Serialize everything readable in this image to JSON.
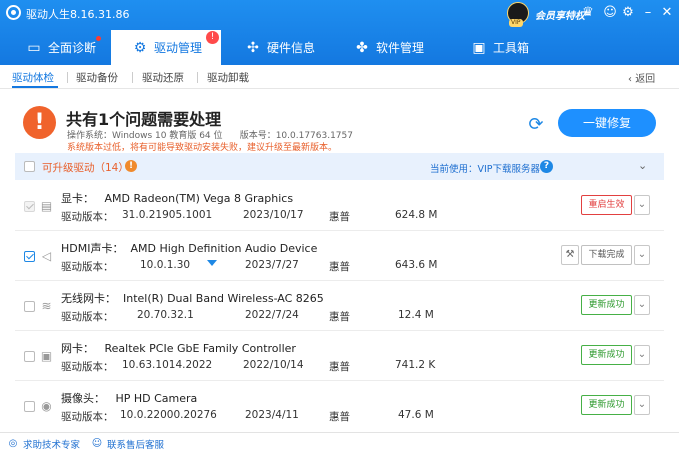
{
  "window": {
    "title": "驱动人生8.16.31.86",
    "member_label": "会员享特权",
    "vip_tag": "VIP"
  },
  "nav": {
    "tabs": [
      {
        "label": "全面诊断",
        "icon": "monitor-icon"
      },
      {
        "label": "驱动管理",
        "icon": "gear-icon",
        "badge": "!"
      },
      {
        "label": "硬件信息",
        "icon": "fan-icon"
      },
      {
        "label": "软件管理",
        "icon": "apps-icon"
      },
      {
        "label": "工具箱",
        "icon": "toolbox-icon"
      }
    ]
  },
  "subtabs": {
    "items": [
      "驱动体检",
      "驱动备份",
      "驱动还原",
      "驱动卸载"
    ],
    "back": "返回"
  },
  "banner": {
    "icon": "!",
    "title": "共有1个问题需要处理",
    "os_info": "操作系统：Windows 10 教育版 64 位      版本号：10.0.17763.1757",
    "warning": "系统版本过低，将有可能导致驱动安装失败，建议升级至最新版本。",
    "fix_button": "一键修复"
  },
  "updatable": {
    "label": "可升级驱动（14）",
    "info_icon": "!",
    "server": "当前使用：VIP下载服务器",
    "help_icon": "?"
  },
  "rows": [
    {
      "name": "显卡：   AMD Radeon(TM) Vega 8 Graphics",
      "ver_label": "驱动版本：",
      "version": "31.0.21905.1001",
      "date": "2023/10/17",
      "vendor": "惠普",
      "size": "624.8 M",
      "action": "重启生效",
      "action_style": "red",
      "icon": "display-card-icon"
    },
    {
      "name": "HDMI声卡：  AMD High Definition Audio Device",
      "ver_label": "驱动版本：",
      "version": "10.0.1.30",
      "date": "2023/7/27",
      "vendor": "惠普",
      "size": "643.6 M",
      "action": "下载完成",
      "action_style": "gray",
      "icon": "speaker-icon"
    },
    {
      "name": "无线网卡：  Intel(R) Dual Band Wireless-AC 8265",
      "ver_label": "驱动版本：",
      "version": "20.70.32.1",
      "date": "2022/7/24",
      "vendor": "惠普",
      "size": "12.4 M",
      "action": "更新成功",
      "action_style": "green",
      "icon": "wifi-icon"
    },
    {
      "name": "网卡：   Realtek PCIe GbE Family Controller",
      "ver_label": "驱动版本：",
      "version": "10.63.1014.2022",
      "date": "2022/10/14",
      "vendor": "惠普",
      "size": "741.2 K",
      "action": "更新成功",
      "action_style": "green",
      "icon": "network-card-icon"
    },
    {
      "name": "摄像头：   HP HD Camera",
      "ver_label": "驱动版本：",
      "version": "10.0.22000.20276",
      "date": "2023/4/11",
      "vendor": "惠普",
      "size": "47.6 M",
      "action": "更新成功",
      "action_style": "green",
      "icon": "camera-icon"
    }
  ],
  "footer": {
    "expert": "求助技术专家",
    "after_sales": "联系售后客服"
  }
}
